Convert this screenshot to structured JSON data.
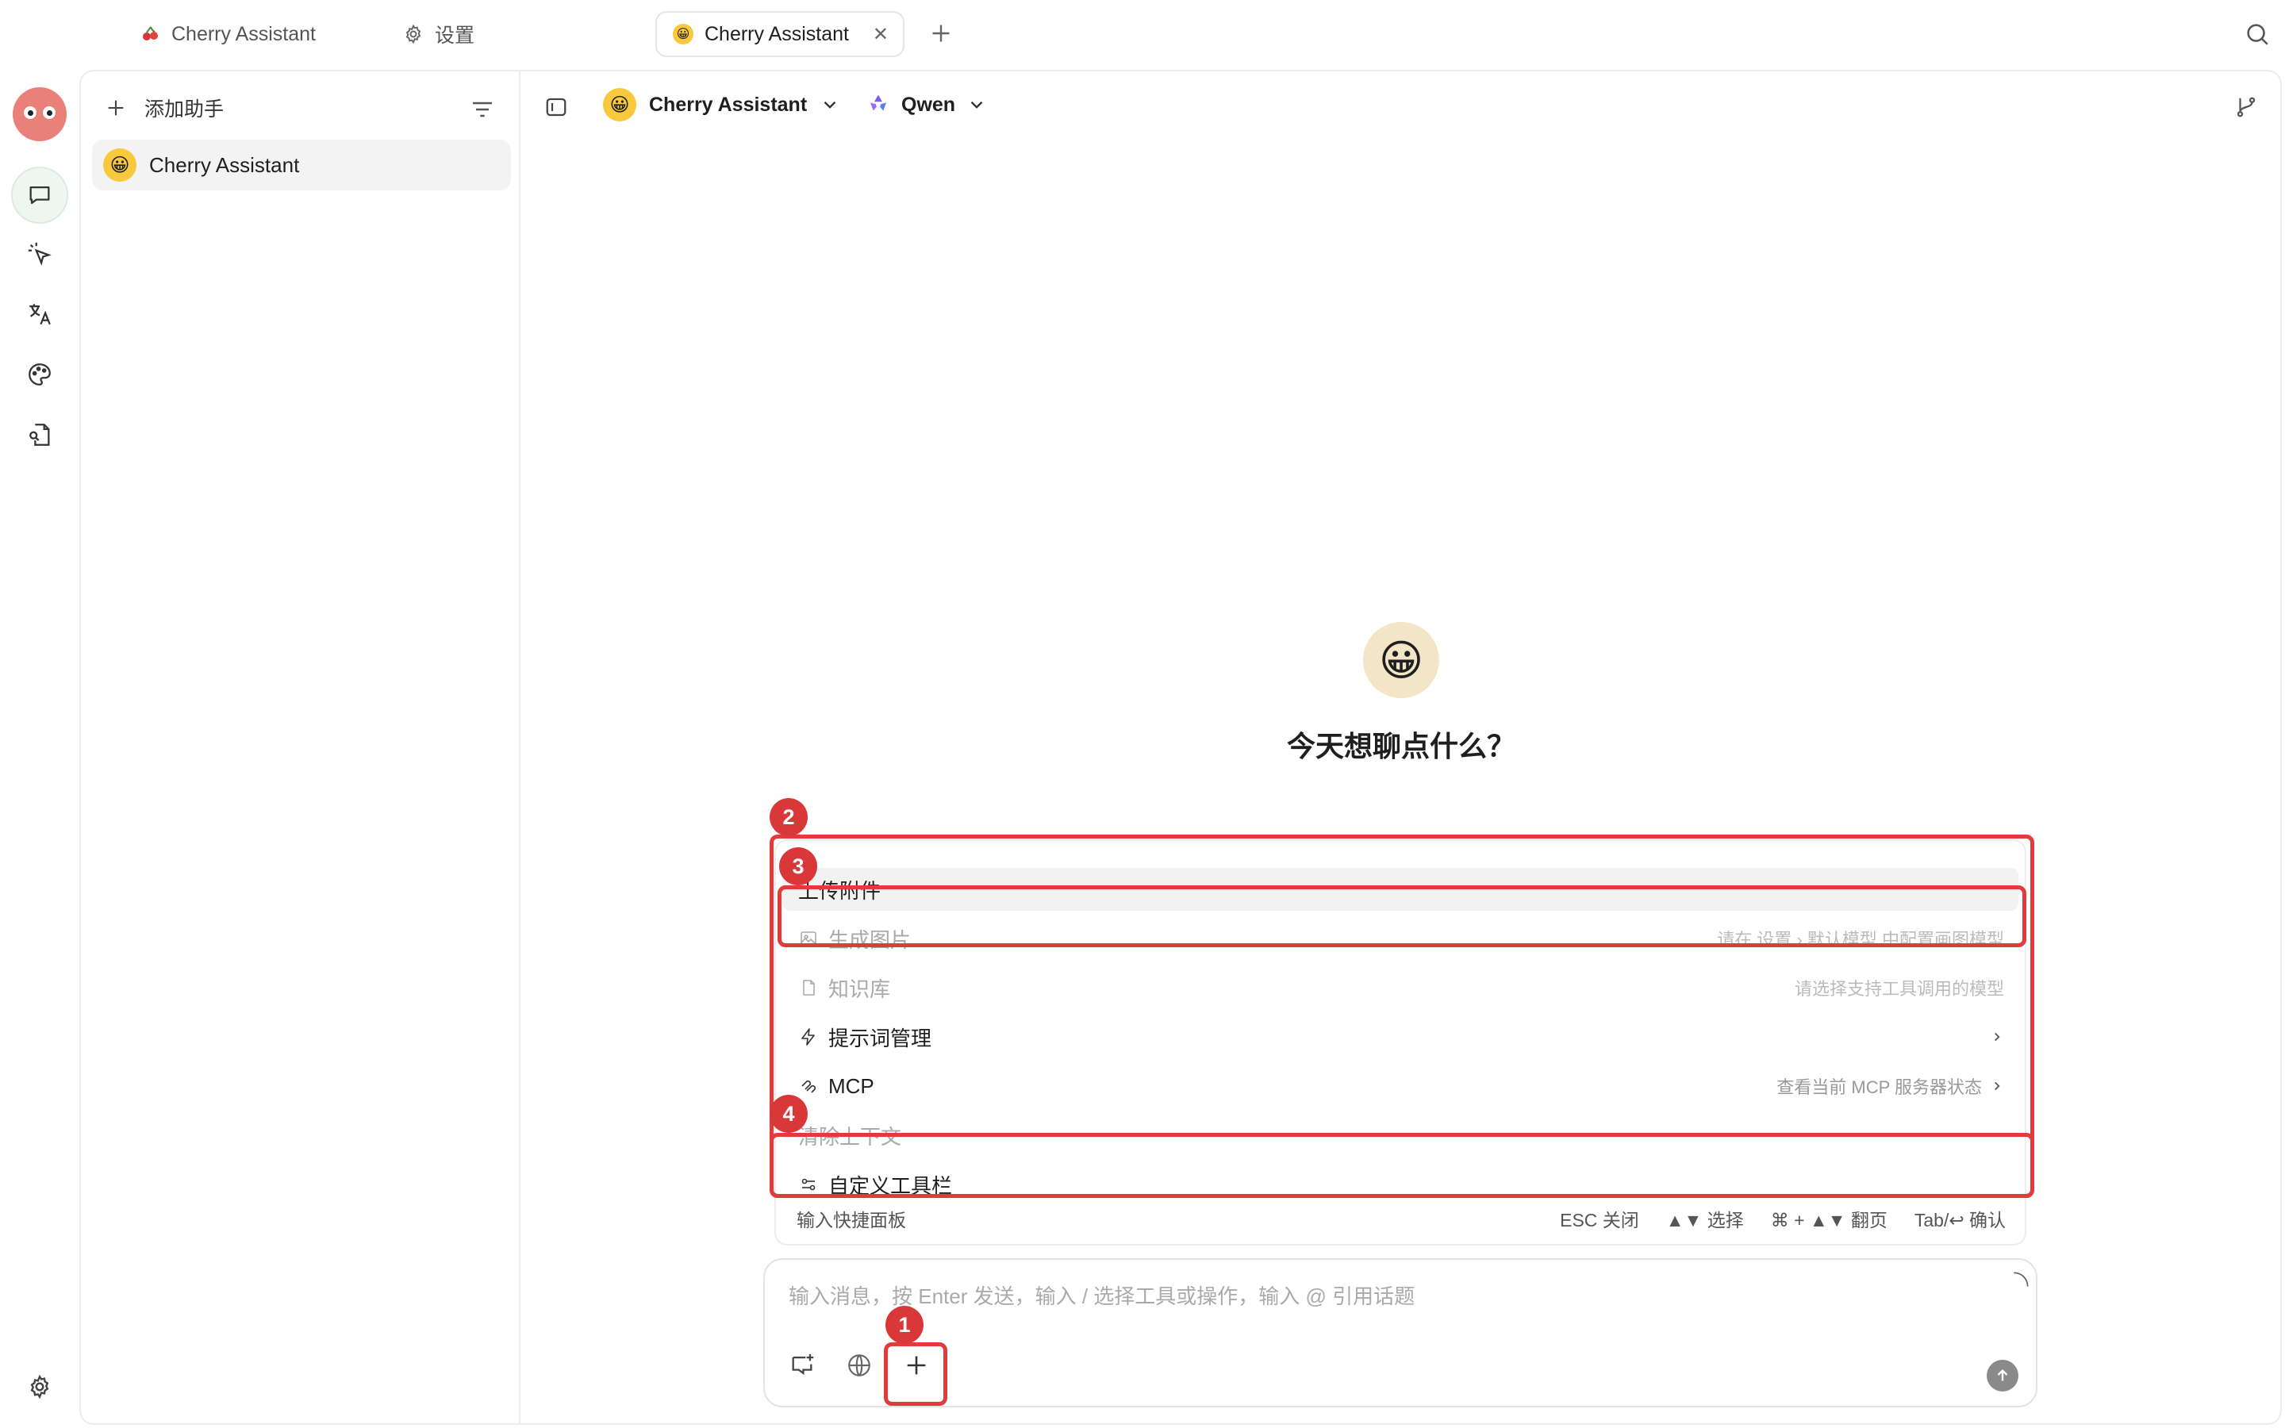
{
  "tabs": [
    {
      "label": "Cherry Assistant",
      "icon": "cherry-icon"
    },
    {
      "label": "设置",
      "icon": "gear-icon"
    },
    {
      "label": "Cherry Assistant",
      "icon": "emoji-icon",
      "active": true
    }
  ],
  "sidebar": {
    "add_label": "添加助手",
    "assistants": [
      {
        "name": "Cherry Assistant",
        "emoji": "😀",
        "selected": true
      }
    ]
  },
  "header": {
    "assistant_name": "Cherry Assistant",
    "assistant_emoji": "😀",
    "model_name": "Qwen"
  },
  "welcome": {
    "emoji": "😀",
    "title": "今天想聊点什么？"
  },
  "quick_panel": {
    "items": [
      {
        "label": "上传附件",
        "hint": "",
        "icon": "",
        "state": "highlighted"
      },
      {
        "label": "生成图片",
        "hint": "请在 设置 › 默认模型 中配置画图模型",
        "icon": "image-icon",
        "state": "disabled"
      },
      {
        "label": "知识库",
        "hint": "请选择支持工具调用的模型",
        "icon": "file-icon",
        "state": "disabled"
      },
      {
        "label": "提示词管理",
        "hint": "",
        "icon": "lightning-icon",
        "state": "normal",
        "arrow": true
      },
      {
        "label": "MCP",
        "hint": "查看当前 MCP 服务器状态",
        "icon": "mcp-icon",
        "state": "normal",
        "arrow": true
      },
      {
        "label": "清除上下文",
        "hint": "",
        "icon": "",
        "state": "disabled"
      },
      {
        "label": "自定义工具栏",
        "hint": "",
        "icon": "sliders-icon",
        "state": "normal"
      }
    ],
    "footer_label": "输入快捷面板",
    "keys": {
      "esc": "ESC 关闭",
      "select": "▲▼ 选择",
      "page": "⌘ + ▲▼ 翻页",
      "confirm": "Tab/↩ 确认"
    }
  },
  "input": {
    "placeholder": "输入消息，按 Enter 发送，输入 / 选择工具或操作，输入 @ 引用话题"
  },
  "annotations": {
    "badge_1": "1",
    "badge_2": "2",
    "badge_3": "3",
    "badge_4": "4",
    "color": "#e23b3b"
  }
}
